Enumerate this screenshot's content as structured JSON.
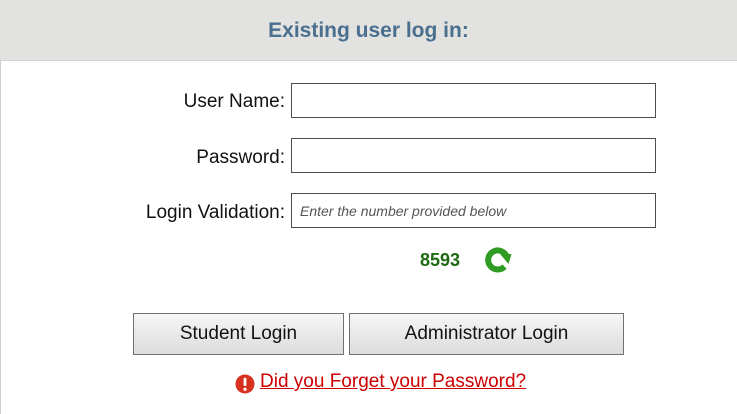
{
  "header": {
    "title": "Existing user log in:"
  },
  "form": {
    "username": {
      "label": "User Name:",
      "value": ""
    },
    "password": {
      "label": "Password:",
      "value": ""
    },
    "validation": {
      "label": "Login Validation:",
      "value": "",
      "placeholder": "Enter the number provided below"
    },
    "captcha": {
      "number": "8593",
      "refresh_icon": "refresh-icon"
    }
  },
  "buttons": {
    "student_login": "Student Login",
    "administrator_login": "Administrator Login"
  },
  "forgot": {
    "icon": "warning-icon",
    "link_text": "Did you Forget your Password?"
  },
  "colors": {
    "header_bg": "#e2e2e0",
    "header_text": "#4a6f8f",
    "captcha_green": "#1e6a12",
    "link_red": "#cc0000",
    "warning_red": "#d9311f"
  }
}
